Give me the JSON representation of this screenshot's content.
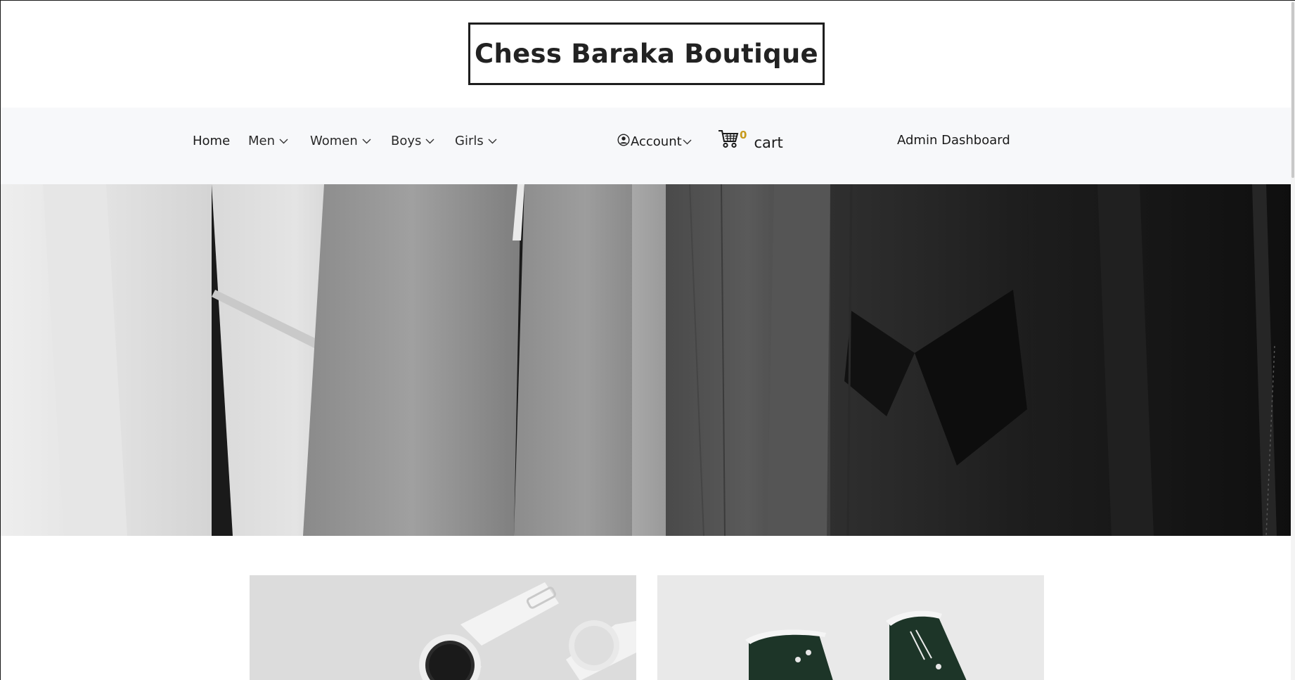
{
  "brand": {
    "title": "Chess Baraka Boutique"
  },
  "nav": {
    "home": "Home",
    "men": "Men",
    "women": "Women",
    "boys": "Boys",
    "girls": "Girls",
    "account": "Account",
    "cart_count": "0",
    "cart_label": "cart",
    "admin": "Admin Dashboard"
  },
  "icons": {
    "account": "user-circle-icon",
    "cart": "shopping-cart-icon",
    "dropdown": "chevron-down-icon"
  },
  "hero": {
    "image": "hanging-clothes-grayscale"
  },
  "products": [
    {
      "image": "smartwatches"
    },
    {
      "image": "green-sneakers"
    }
  ],
  "colors": {
    "navbar_bg": "#f7f8fa",
    "cart_count": "#c79a1b",
    "text": "#1a1a1a"
  }
}
